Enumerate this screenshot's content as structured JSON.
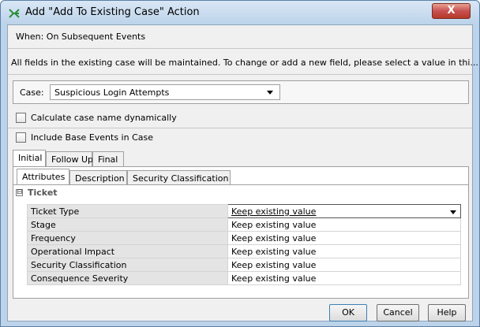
{
  "window": {
    "title": "Add \"Add To Existing Case\" Action",
    "close_label": "X"
  },
  "trigger_text": "When: On Subsequent Events",
  "info_text": "All fields in the existing case will be maintained. To change or add a new field, please select a value in thi...",
  "case": {
    "label": "Case:",
    "selected": "Suspicious Login Attempts"
  },
  "checkboxes": {
    "calc_name": "Calculate case name dynamically",
    "include_base": "Include Base Events in Case"
  },
  "outer_tabs": [
    "Initial",
    "Follow Up",
    "Final"
  ],
  "inner_tabs": [
    "Attributes",
    "Description",
    "Security Classification"
  ],
  "group": {
    "collapse_symbol": "⊟",
    "label": "Ticket"
  },
  "properties": [
    {
      "name": "Ticket Type",
      "value": "Keep existing value"
    },
    {
      "name": "Stage",
      "value": "Keep existing value"
    },
    {
      "name": "Frequency",
      "value": "Keep existing value"
    },
    {
      "name": "Operational Impact",
      "value": "Keep existing value"
    },
    {
      "name": "Security Classification",
      "value": "Keep existing value"
    },
    {
      "name": "Consequence Severity",
      "value": "Keep existing value"
    }
  ],
  "buttons": {
    "ok": "OK",
    "cancel": "Cancel",
    "help": "Help"
  },
  "colors": {
    "title_bar": "#bcd3ea",
    "close_button": "#c75050",
    "property_name_bg": "#e4e4e4"
  }
}
